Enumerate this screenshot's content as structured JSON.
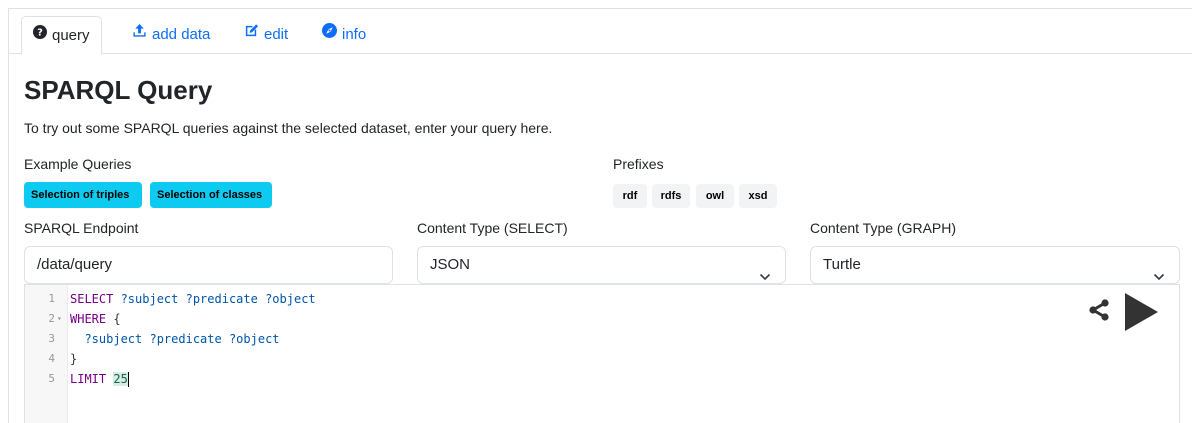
{
  "tabs": [
    {
      "label": "query",
      "icon": "question-circle-icon",
      "active": true
    },
    {
      "label": "add data",
      "icon": "upload-icon",
      "active": false
    },
    {
      "label": "edit",
      "icon": "edit-icon",
      "active": false
    },
    {
      "label": "info",
      "icon": "compass-icon",
      "active": false
    }
  ],
  "page": {
    "title": "SPARQL Query",
    "description": "To try out some SPARQL queries against the selected dataset, enter your query here."
  },
  "examples": {
    "label": "Example Queries",
    "items": [
      "Selection of triples",
      "Selection of classes"
    ]
  },
  "prefixes": {
    "label": "Prefixes",
    "items": [
      "rdf",
      "rdfs",
      "owl",
      "xsd"
    ]
  },
  "endpoint": {
    "label": "SPARQL Endpoint",
    "value": "/data/query"
  },
  "content_select": {
    "label": "Content Type (SELECT)",
    "value": "JSON"
  },
  "content_graph": {
    "label": "Content Type (GRAPH)",
    "value": "Turtle"
  },
  "editor": {
    "line_numbers": [
      "1",
      "2",
      "3",
      "4",
      "5"
    ],
    "lines": {
      "l1_kw": "SELECT",
      "l1_rest": " ?subject ?predicate ?object",
      "l2_kw": "WHERE",
      "l2_rest": " {",
      "l3": "  ?subject ?predicate ?object",
      "l4": "}",
      "l5_kw": "LIMIT",
      "l5_num": "25"
    }
  },
  "colors": {
    "link": "#0d6efd",
    "info_button": "#0dcaf0",
    "run": "#333333"
  }
}
